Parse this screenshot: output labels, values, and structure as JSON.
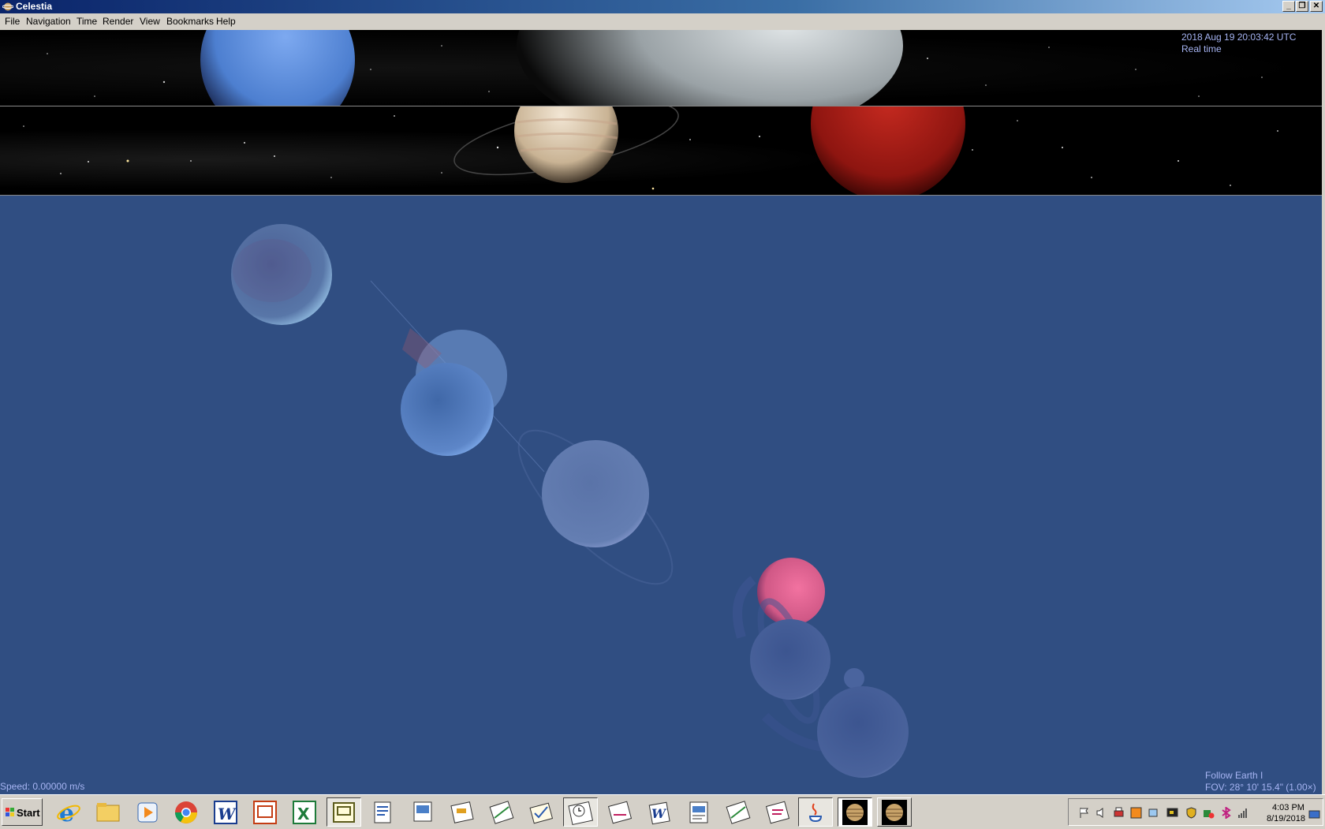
{
  "window": {
    "title": "Celestia",
    "minimize": "_",
    "restore": "❐",
    "close": "✕"
  },
  "menu": [
    "File",
    "Navigation",
    "Time",
    "Render",
    "View",
    "Bookmarks",
    "Help"
  ],
  "overlay": {
    "datetime": "2018 Aug 19 20:03:42 UTC",
    "time_mode": "Real time",
    "speed": "Speed: 0.00000 m/s",
    "follow": "Follow Earth I",
    "fov": "FOV: 28° 10' 15.4\" (1.00×)"
  },
  "colors": {
    "main_view_bg": "#304e82",
    "overlay_text": "#a6b4f2",
    "chrome": "#d4d0c8"
  },
  "taskbar": {
    "start_label": "Start",
    "pinned_icons": [
      "internet-explorer-icon",
      "file-explorer-icon",
      "media-player-icon",
      "chrome-icon",
      "word-icon",
      "powerpoint-icon",
      "excel-icon",
      "publisher-icon",
      "document-icon",
      "document-icon",
      "document-icon",
      "document-icon",
      "document-icon",
      "clock-document-icon",
      "document-icon",
      "word-document-icon",
      "document-icon",
      "document-icon",
      "document-icon",
      "java-icon"
    ],
    "running_windows": [
      "celestia-window-1",
      "celestia-window-2"
    ],
    "tray_icons": [
      "flag-icon",
      "volume-icon",
      "printer-icon",
      "app-icon",
      "network-icon",
      "monitor-icon",
      "shield-icon",
      "security-icon",
      "bluetooth-icon",
      "signal-icon"
    ],
    "clock_time": "4:03 PM",
    "clock_date": "8/19/2018"
  }
}
